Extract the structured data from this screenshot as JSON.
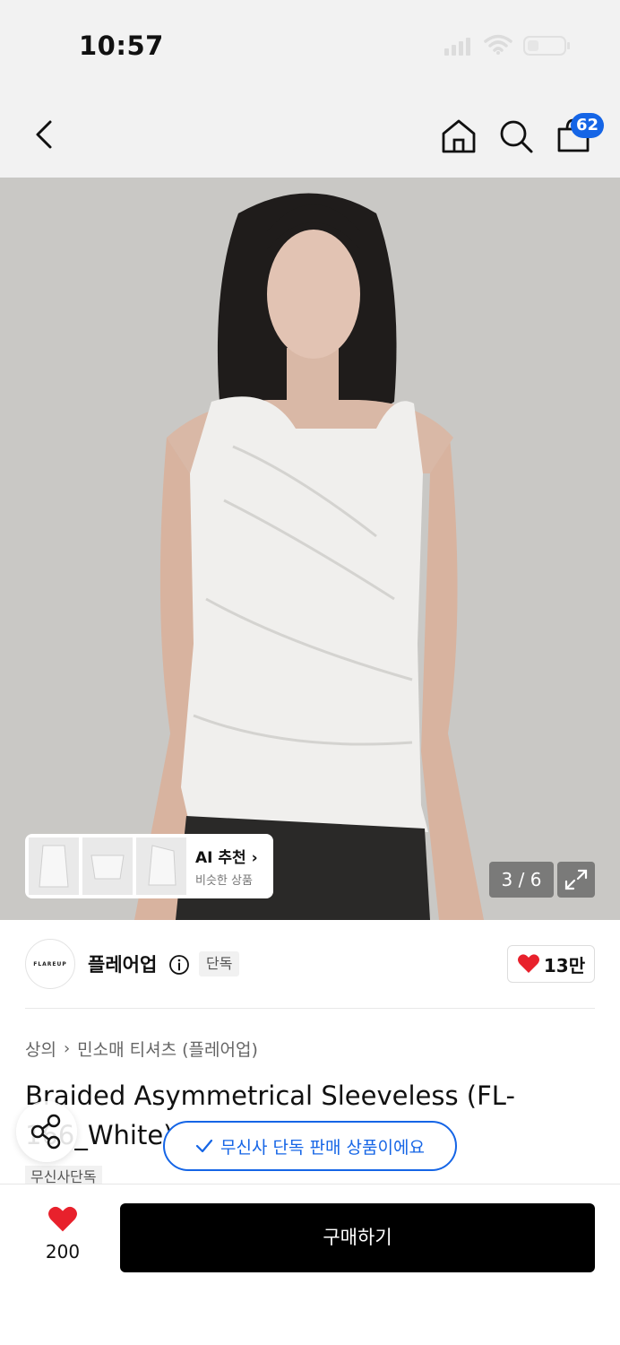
{
  "status_bar": {
    "time": "10:57"
  },
  "nav": {
    "cart_count": "62"
  },
  "gallery": {
    "counter": "3 / 6",
    "ai": {
      "title": "AI 추천",
      "subtitle": "비슷한 상품"
    }
  },
  "brand": {
    "logo_text": "FLAREUP",
    "name": "플레어업",
    "tag": "단독",
    "likes": "13만"
  },
  "product": {
    "breadcrumb": [
      "상의",
      "민소매 티셔츠 (플레어업)"
    ],
    "title": "Braided Asymmetrical Sleeveless (FL-166_White)",
    "exclusive_chip": "무신사단독"
  },
  "toast": {
    "text": "무신사 단독 판매 상품이에요"
  },
  "bottom": {
    "like_count": "200",
    "buy_label": "구매하기"
  },
  "colors": {
    "accent": "#1565e6",
    "heart": "#e8212c",
    "buy_bg": "#000000"
  }
}
